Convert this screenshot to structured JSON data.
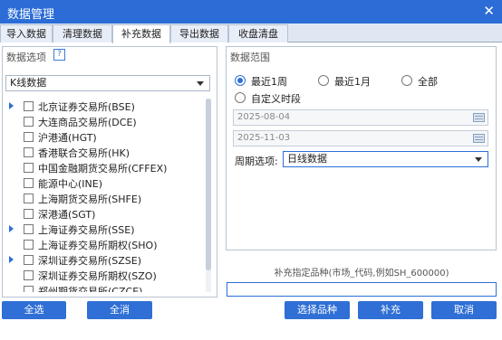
{
  "window": {
    "title": "数据管理",
    "close_icon": "close-icon"
  },
  "tabs": [
    {
      "label": "导入数据",
      "active": false
    },
    {
      "label": "清理数据",
      "active": false
    },
    {
      "label": "补充数据",
      "active": true
    },
    {
      "label": "导出数据",
      "active": false
    },
    {
      "label": "收盘清盘",
      "active": false
    }
  ],
  "left_panel": {
    "title": "数据选项",
    "help_label": "?",
    "data_type": "K线数据",
    "tree": [
      {
        "label": "北京证券交易所(BSE)",
        "expandable": true,
        "checked": false
      },
      {
        "label": "大连商品交易所(DCE)",
        "expandable": false,
        "checked": false
      },
      {
        "label": "沪港通(HGT)",
        "expandable": false,
        "checked": false
      },
      {
        "label": "香港联合交易所(HK)",
        "expandable": false,
        "checked": false
      },
      {
        "label": "中国金融期货交易所(CFFEX)",
        "expandable": false,
        "checked": false
      },
      {
        "label": "能源中心(INE)",
        "expandable": false,
        "checked": false
      },
      {
        "label": "上海期货交易所(SHFE)",
        "expandable": false,
        "checked": false
      },
      {
        "label": "深港通(SGT)",
        "expandable": false,
        "checked": false
      },
      {
        "label": "上海证券交易所(SSE)",
        "expandable": true,
        "checked": false
      },
      {
        "label": "上海证券交易所期权(SHO)",
        "expandable": false,
        "checked": false
      },
      {
        "label": "深圳证券交易所(SZSE)",
        "expandable": true,
        "checked": false
      },
      {
        "label": "深圳证券交易所期权(SZO)",
        "expandable": false,
        "checked": false
      },
      {
        "label": "郑州期货交易所(CZCE)",
        "expandable": false,
        "checked": false
      }
    ]
  },
  "right_panel": {
    "title": "数据范围",
    "radios": [
      {
        "label": "最近1周",
        "checked": true
      },
      {
        "label": "最近1月",
        "checked": false
      },
      {
        "label": "全部",
        "checked": false
      },
      {
        "label": "自定义时段",
        "checked": false
      }
    ],
    "start_date": "2025-08-04",
    "end_date": "2025-11-03",
    "period_label": "周期选项:",
    "period_value": "日线数据"
  },
  "supplement": {
    "hint": "补充指定品种(市场_代码,例如SH_600000)",
    "value": ""
  },
  "buttons": {
    "select_all": "全选",
    "clear_all": "全消",
    "choose_symbol": "选择品种",
    "supplement": "补充",
    "cancel": "取消"
  },
  "colors": {
    "titlebar": "#2b6cd6",
    "accent": "#2f6fd6"
  }
}
